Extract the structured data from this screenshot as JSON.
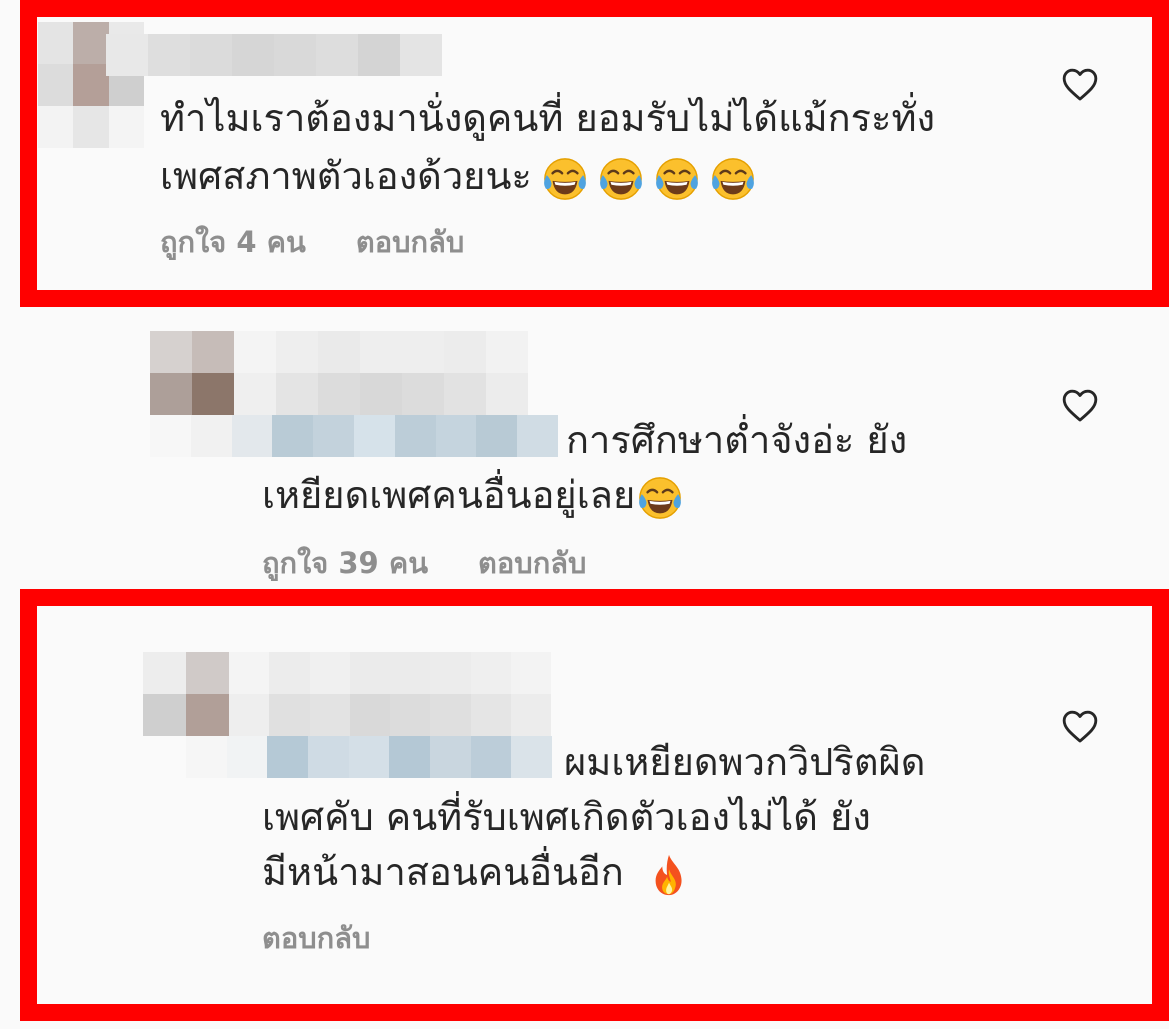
{
  "comments": [
    {
      "lines": [
        "ทำไมเราต้องมานั่งดูคนที่ ยอมรับไม่ได้แม้กระทั่ง",
        "เพศสภาพตัวเองด้วยนะ"
      ],
      "emoji": "face-with-tears-of-joy-emoji",
      "emoji_count": 4,
      "likes_label": "ถูกใจ 4 คน",
      "reply_label": "ตอบกลับ",
      "highlighted": true
    },
    {
      "lines": [
        "การศึกษาต่ำจังอ่ะ ยัง",
        "เหยียดเพศคนอื่นอยู่เลย"
      ],
      "emoji": "face-with-tears-of-joy-emoji",
      "emoji_count": 1,
      "likes_label": "ถูกใจ 39 คน",
      "reply_label": "ตอบกลับ",
      "highlighted": false
    },
    {
      "lines": [
        "ผมเหยียดพวกวิปริตผิด",
        "เพศคับ คนที่รับเพศเกิดตัวเองไม่ได้ ยัง",
        "มีหน้ามาสอนคนอื่นอีก"
      ],
      "emoji": "fire-emoji",
      "emoji_count": 1,
      "reply_label": "ตอบกลับ",
      "highlighted": true
    }
  ],
  "icons": {
    "like": "heart-outline-icon",
    "username": "pixelated-username-censor"
  },
  "colors": {
    "highlight_border": "#ff0000",
    "background": "#fafafa",
    "text": "#262626",
    "meta_text": "#8e8e8e",
    "censor_blue": "#b3c9d8"
  }
}
